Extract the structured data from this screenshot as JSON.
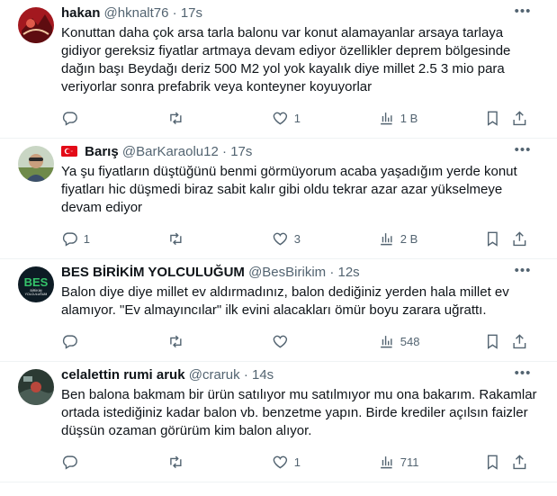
{
  "tweets": [
    {
      "name": "hakan",
      "handle": "@hknalt76",
      "time": "17s",
      "text": "Konuttan daha çok arsa tarla balonu var konut alamayanlar arsaya tarlaya gidiyor gereksiz fiyatlar artmaya devam ediyor özellikler deprem bölgesinde dağın başı Beydağı deriz 500 M2 yol yok kayalık diye millet 2.5 3 mio para veriyorlar sonra prefabrik veya konteyner koyuyorlar",
      "replies": "",
      "retweets": "",
      "likes": "1",
      "views": "1 B",
      "avatar_color": "#a3181f"
    },
    {
      "name": "Barış",
      "handle": "@BarKaraolu12",
      "time": "17s",
      "text": "Ya şu fiyatların düştüğünü benmi görmüyorum acaba yaşadığım yerde konut fiyatları hic düşmedi biraz sabit kalır gibi oldu tekrar azar azar yükselmeye devam ediyor",
      "replies": "1",
      "retweets": "",
      "likes": "3",
      "views": "2 B",
      "avatar_color": "#6f8a4a"
    },
    {
      "name": "BES BİRİKİM YOLCULUĞUM",
      "handle": "@BesBirikim",
      "time": "12s",
      "text": "Balon diye diye millet ev aldırmadınız, balon dediğiniz yerden hala millet ev alamıyor. \"Ev almayıncılar\" ilk evini alacakları ömür boyu zarara uğrattı.",
      "replies": "",
      "retweets": "",
      "likes": "",
      "views": "548",
      "avatar_color": "#0d1b24",
      "logo_text": "BES",
      "logo_sub1": "BİRİKİM",
      "logo_sub2": "YOLCULUĞUM"
    },
    {
      "name": "celalettin rumi aruk",
      "handle": "@craruk",
      "time": "14s",
      "text": "Ben balona bakmam bir ürün satılıyor mu satılmıyor mu ona bakarım. Rakamlar ortada istediğiniz kadar balon vb. benzetme yapın. Birde krediler açılsın faizler düşsün ozaman görürüm kim balon alıyor.",
      "replies": "",
      "retweets": "",
      "likes": "1",
      "views": "711",
      "avatar_color": "#2b3a33"
    }
  ],
  "separator": "·",
  "colors": {
    "text": "#0f1419",
    "muted": "#536471",
    "border": "#eff3f4",
    "logo_green": "#35c46a"
  }
}
